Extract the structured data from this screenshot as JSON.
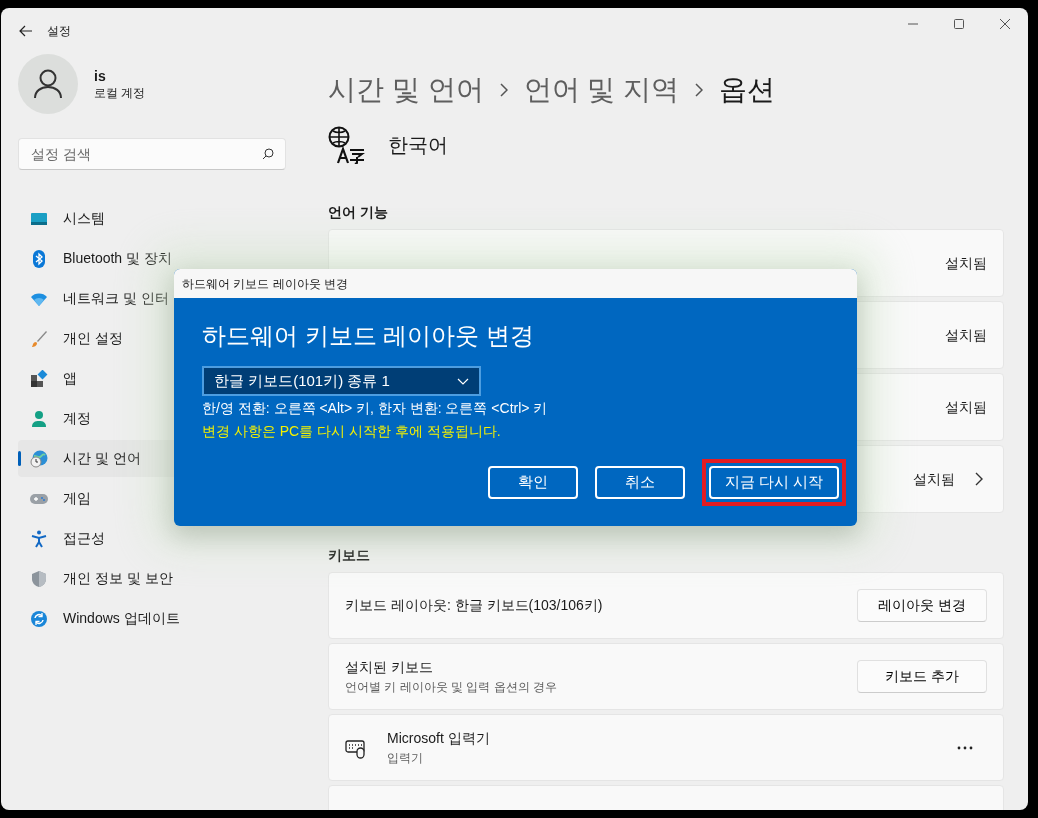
{
  "window": {
    "title": "설정"
  },
  "account": {
    "name": "is",
    "type": "로컬 계정"
  },
  "search": {
    "placeholder": "설정 검색"
  },
  "sidebar": {
    "items": [
      {
        "label": "시스템",
        "selected": false
      },
      {
        "label": "Bluetooth 및 장치",
        "selected": false
      },
      {
        "label": "네트워크 및 인터",
        "selected": false
      },
      {
        "label": "개인 설정",
        "selected": false
      },
      {
        "label": "앱",
        "selected": false
      },
      {
        "label": "계정",
        "selected": false
      },
      {
        "label": "시간 및 언어",
        "selected": true
      },
      {
        "label": "게임",
        "selected": false
      },
      {
        "label": "접근성",
        "selected": false
      },
      {
        "label": "개인 정보 및 보안",
        "selected": false
      },
      {
        "label": "Windows 업데이트",
        "selected": false
      }
    ]
  },
  "breadcrumb": [
    "시간 및 언어",
    "언어 및 지역",
    "옵션"
  ],
  "language": "한국어",
  "language_features": {
    "heading": "언어 기능",
    "rows": [
      {
        "status": "설치됨",
        "expandable": false
      },
      {
        "status": "설치됨",
        "expandable": false
      },
      {
        "status": "설치됨",
        "expandable": false
      },
      {
        "status": "설치됨",
        "expandable": true
      }
    ]
  },
  "keyboard": {
    "heading": "키보드",
    "layout": {
      "text": "키보드 레이아웃: 한글 키보드(103/106키)",
      "button": "레이아웃 변경"
    },
    "installed": {
      "title": "설치된 키보드",
      "subtitle": "언어별 키 레이아웃 및 입력 옵션의 경우",
      "button": "키보드 추가"
    },
    "ime": {
      "title": "Microsoft 입력기",
      "subtitle": "입력기"
    }
  },
  "dialog": {
    "title": "하드웨어 키보드 레이아웃 변경",
    "heading": "하드웨어 키보드 레이아웃 변경",
    "select_value": "한글 키보드(101키) 종류 1",
    "info": "한/영 전환: 오른쪽 <Alt> 키, 한자 변환: 오른쪽 <Ctrl> 키",
    "warning": "변경 사항은 PC를 다시 시작한 후에 적용됩니다.",
    "buttons": [
      {
        "label": "확인",
        "highlighted": false
      },
      {
        "label": "취소",
        "highlighted": false
      },
      {
        "label": "지금 다시 시작",
        "highlighted": true
      }
    ]
  }
}
